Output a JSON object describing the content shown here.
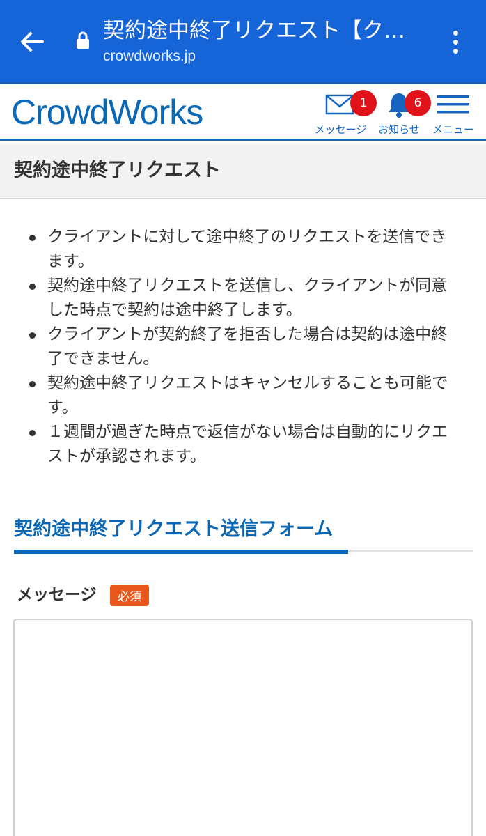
{
  "browser": {
    "tab_title": "契約途中終了リクエスト【ク…",
    "url": "crowdworks.jp",
    "back_icon": "arrow-left-icon",
    "lock_icon": "lock-icon",
    "menu_icon": "kebab-menu-icon",
    "bar_color": "#1565d8"
  },
  "header": {
    "logo": "CrowdWorks",
    "nav": [
      {
        "label": "メッセージ",
        "icon": "envelope-icon",
        "badge": "1"
      },
      {
        "label": "お知らせ",
        "icon": "bell-icon",
        "badge": "6"
      },
      {
        "label": "メニュー",
        "icon": "hamburger-icon"
      }
    ],
    "brand_color": "#0b68b5",
    "badge_color": "#e0131b"
  },
  "page": {
    "title": "契約途中終了リクエスト"
  },
  "info": [
    "クライアントに対して途中終了のリクエストを送信できます。",
    "契約途中終了リクエストを送信し、クライアントが同意した時点で契約は途中終了します。",
    "クライアントが契約終了を拒否した場合は契約は途中終了できません。",
    "契約途中終了リクエストはキャンセルすることも可能です。",
    "１週間が過ぎた時点で返信がない場合は自動的にリクエストが承認されます。"
  ],
  "form": {
    "heading": "契約途中終了リクエスト送信フォーム",
    "message_label": "メッセージ",
    "required_label": "必須",
    "message_value": "",
    "required_color": "#e9571c"
  }
}
